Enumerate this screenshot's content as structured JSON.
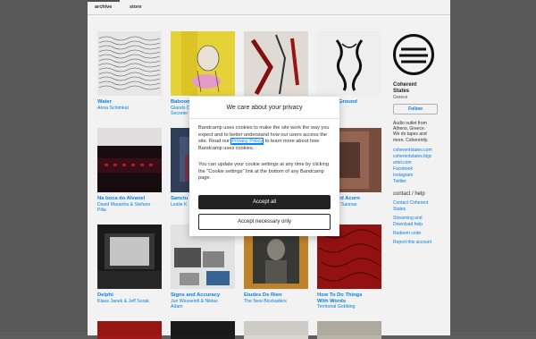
{
  "nav": {
    "tabs": [
      "archive",
      "store"
    ]
  },
  "releases": [
    {
      "title": "Water",
      "artist": "Anna Schimkat",
      "art": "waves"
    },
    {
      "title": "Baboon",
      "artist": "Glands O",
      "artist2": "Secretio",
      "art": "yellow"
    },
    {
      "title": "",
      "artist": "",
      "art": "red-print"
    },
    {
      "title": "Ground",
      "artist": "",
      "art": "figure"
    },
    {
      "title": "Na boca do Alvanel",
      "artist": "David Maranha & Stefano",
      "artist2": "Pilia",
      "art": "red-dark"
    },
    {
      "title": "Sanctu",
      "artist": "Leslie K",
      "art": "blue"
    },
    {
      "title": "",
      "artist": "",
      "art": "blank"
    },
    {
      "title": "rd Acorn",
      "artist": "/ Sannas",
      "art": "rust"
    },
    {
      "title": "Delphi",
      "artist": "Klaus Janek & Jeff Surak",
      "art": "stage"
    },
    {
      "title": "Signs and Accuracy",
      "artist": "Jun Wesselofi & Niklas",
      "artist2": "Adam",
      "art": "collage"
    },
    {
      "title": "Etudes De Rien",
      "artist": "The New Blockaders",
      "art": "portrait"
    },
    {
      "title": "How To Do Things",
      "title2": "With Words",
      "artist": "Territorial Gobbing",
      "art": "red-texture"
    }
  ],
  "sidebar": {
    "name": "Coherent",
    "name2": "States",
    "location": "Greece",
    "follow": "Follow",
    "desc": [
      "Audio outlet from",
      "Athens, Greece.",
      "We do tapes and",
      "more. Coherently."
    ],
    "links": [
      "coherentstates.com",
      "coherentstates.bigc",
      "artel.com",
      "Facebook",
      "Instagram",
      "Twitter"
    ],
    "contact_heading": "contact / help",
    "contact_links": [
      "Contact Coherent",
      "States",
      "Streaming and",
      "Download help",
      "Redeem code",
      "Report this account"
    ]
  },
  "modal": {
    "title": "We care about your privacy",
    "p1_pre": "Bandcamp uses cookies to make the site work the way you expect and to better understand how our users access the site. Read our ",
    "p1_link": "Privacy Policy",
    "p1_post": " to learn more about how Bandcamp uses cookies.",
    "p2": "You can update your cookie settings at any time by clicking the \"Cookie settings\" link at the bottom of any Bandcamp page.",
    "accept_all": "Accept all",
    "accept_necessary": "Accept necessary only"
  }
}
